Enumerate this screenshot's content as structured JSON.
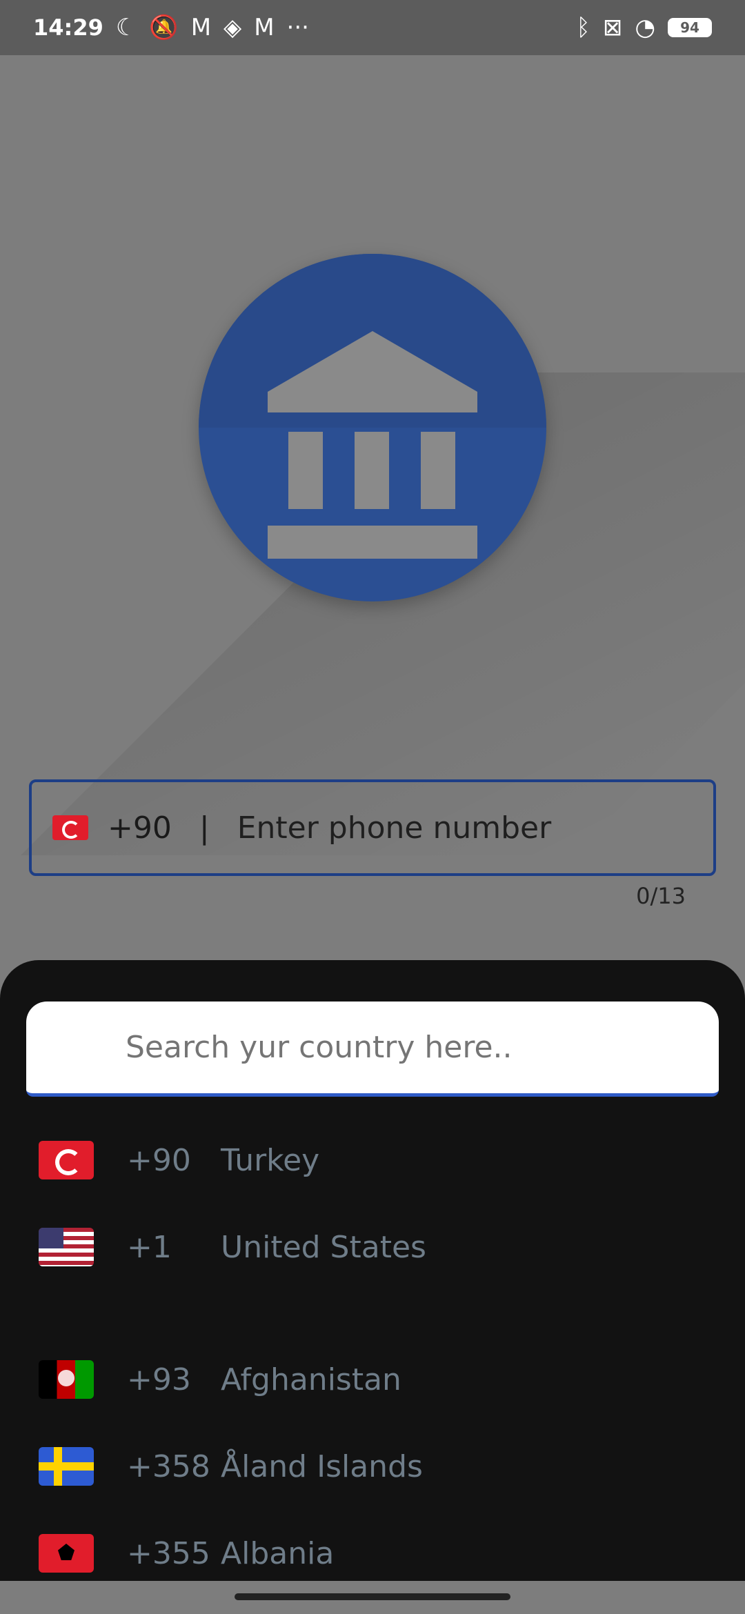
{
  "status": {
    "time": "14:29",
    "left_icons": [
      "moon-icon",
      "bell-off-icon",
      "gmail-icon",
      "layers-icon",
      "gmail-icon",
      "more-dots-icon"
    ],
    "right_icons": [
      "bluetooth-icon",
      "cross-box-icon",
      "wifi-icon"
    ],
    "battery": "94"
  },
  "phone_input": {
    "country_code": "+90",
    "separator": "|",
    "placeholder": "Enter phone number",
    "counter": "0/13"
  },
  "picker": {
    "search_placeholder": "Search yur country here..",
    "countries": [
      {
        "code": "+90",
        "name": "Turkey"
      },
      {
        "code": "+1",
        "name": "United States"
      },
      {
        "code": "+93",
        "name": "Afghanistan"
      },
      {
        "code": "+358",
        "name": "Åland Islands"
      },
      {
        "code": "+355",
        "name": "Albania"
      }
    ]
  }
}
